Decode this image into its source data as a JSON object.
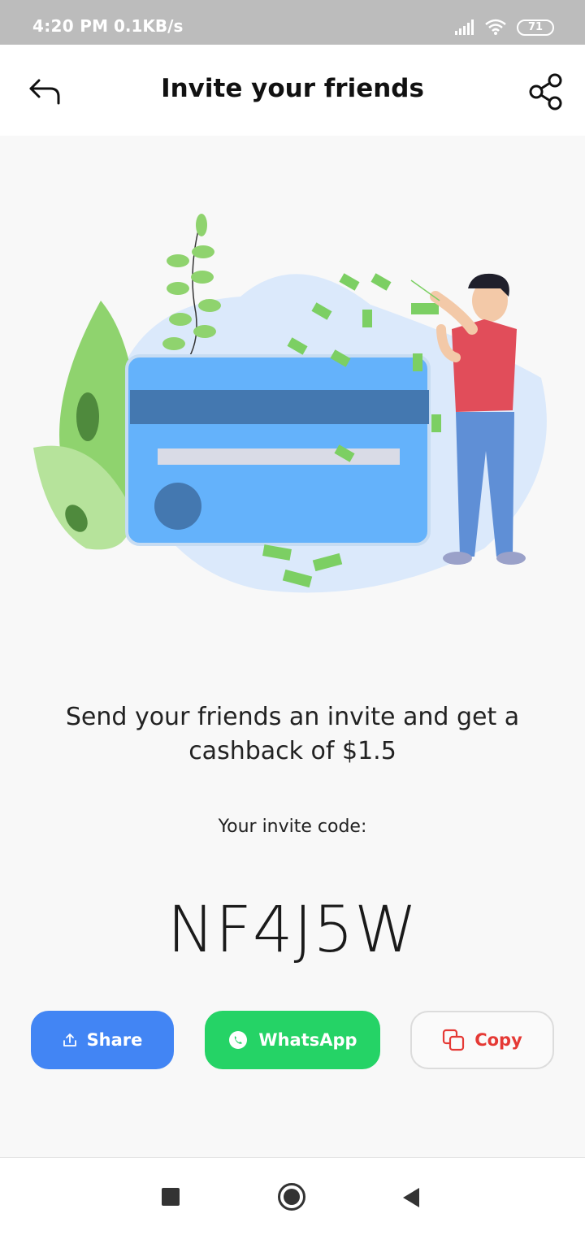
{
  "status_bar": {
    "time": "4:20 PM",
    "network_speed": "0.1KB/s",
    "battery": "71",
    "icons": [
      "signal-icon",
      "wifi-icon",
      "battery-icon"
    ]
  },
  "header": {
    "title": "Invite your friends",
    "back_icon": "back-arrow-icon",
    "share_icon": "share-icon"
  },
  "illustration": {
    "description_icon": "credit-card-cashback-illustration"
  },
  "invite": {
    "message": "Send your friends an invite and get a cashback of $1.5",
    "code_label": "Your invite code:",
    "code": "NF4J5W"
  },
  "actions": {
    "share_label": "Share",
    "whatsapp_label": "WhatsApp",
    "copy_label": "Copy"
  },
  "colors": {
    "share_button": "#4285f4",
    "whatsapp_button": "#25d366",
    "copy_text": "#e53935"
  },
  "nav_bar": {
    "icons": [
      "recent-apps-icon",
      "home-icon",
      "back-icon"
    ]
  }
}
